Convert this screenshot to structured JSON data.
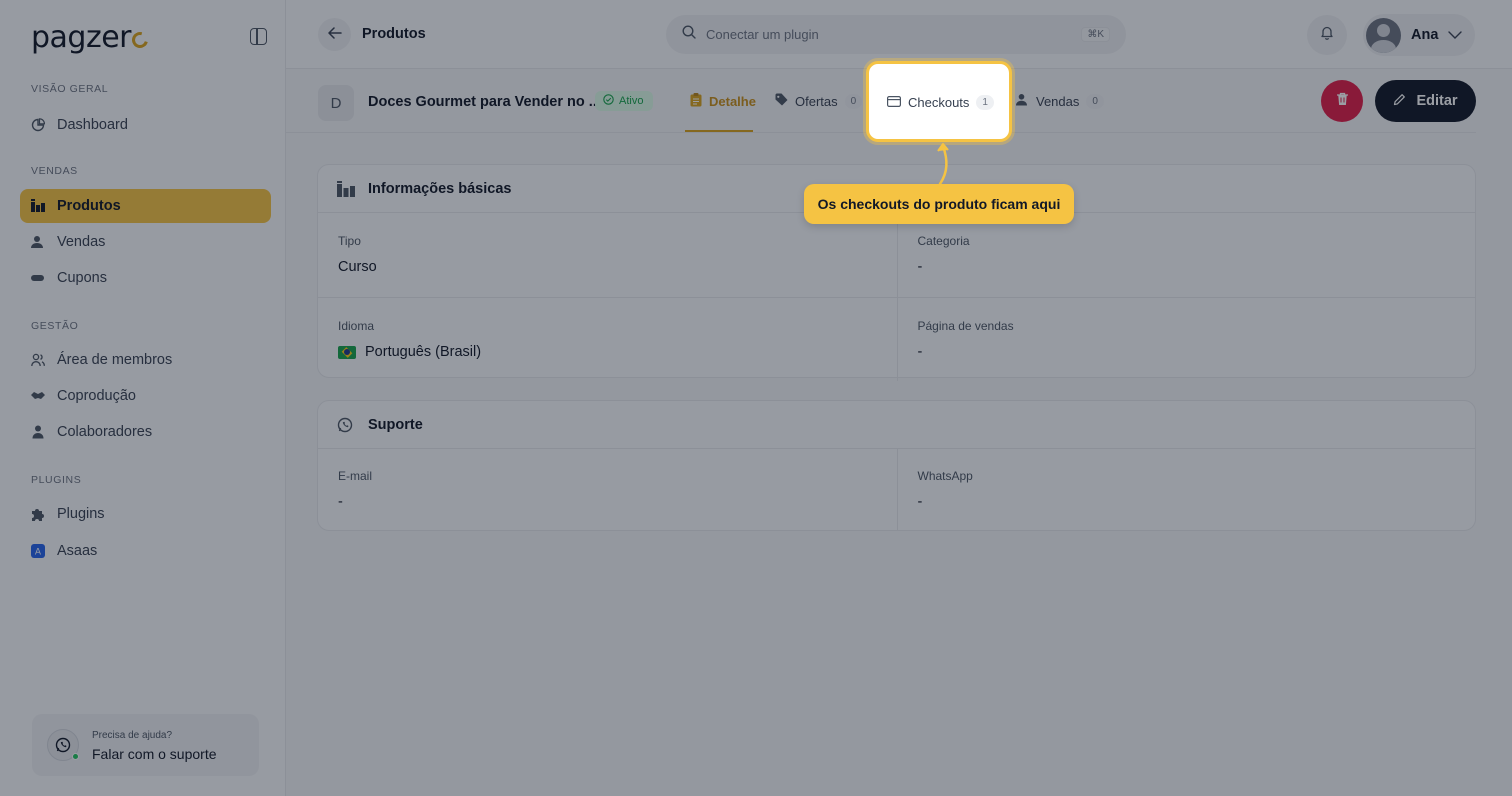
{
  "app": {
    "logo_text": "pagzer",
    "colors": {
      "accent": "#f5c343",
      "accent_dark": "#d9a21b",
      "danger": "#e11d48",
      "dark": "#111827",
      "success": "#16a34a"
    }
  },
  "sidebar": {
    "sections": [
      {
        "label": "VISÃO GERAL",
        "items": [
          {
            "label": "Dashboard",
            "icon": "pie-chart-icon"
          }
        ]
      },
      {
        "label": "VENDAS",
        "items": [
          {
            "label": "Produtos",
            "icon": "boxes-icon",
            "active": true
          },
          {
            "label": "Vendas",
            "icon": "user-money-icon"
          },
          {
            "label": "Cupons",
            "icon": "ticket-icon"
          }
        ]
      },
      {
        "label": "GESTÃO",
        "items": [
          {
            "label": "Área de membros",
            "icon": "users-icon"
          },
          {
            "label": "Coprodução",
            "icon": "handshake-icon"
          },
          {
            "label": "Colaboradores",
            "icon": "user-icon"
          }
        ]
      },
      {
        "label": "PLUGINS",
        "items": [
          {
            "label": "Plugins",
            "icon": "puzzle-icon"
          },
          {
            "label": "Asaas",
            "icon": "asaas-logo-icon"
          }
        ]
      }
    ],
    "help": {
      "small": "Precisa de ajuda?",
      "big": "Falar com o suporte",
      "icon": "whatsapp-icon"
    }
  },
  "topbar": {
    "title": "Produtos",
    "search_placeholder": "Conectar um plugin",
    "search_shortcut": "⌘K",
    "user_name": "Ana"
  },
  "product": {
    "initial": "D",
    "name": "Doces Gourmet para Vender no ...",
    "status": "Ativo",
    "tabs": [
      {
        "label": "Detalhe",
        "active": true
      },
      {
        "label": "Ofertas",
        "count": "0"
      },
      {
        "label": "Checkouts",
        "count": "1"
      },
      {
        "label": "Vendas",
        "count": "0"
      }
    ],
    "edit_label": "Editar"
  },
  "basic_info": {
    "title": "Informações básicas",
    "fields": [
      {
        "label": "Tipo",
        "value": "Curso"
      },
      {
        "label": "Categoria",
        "value": "-"
      },
      {
        "label": "Idioma",
        "value": "Português (Brasil)"
      },
      {
        "label": "Página de vendas",
        "value": "-"
      }
    ]
  },
  "support": {
    "title": "Suporte",
    "fields": [
      {
        "label": "E-mail",
        "value": "-"
      },
      {
        "label": "WhatsApp",
        "value": "-"
      }
    ]
  },
  "tour": {
    "tooltip": "Os checkouts do produto ficam aqui"
  }
}
